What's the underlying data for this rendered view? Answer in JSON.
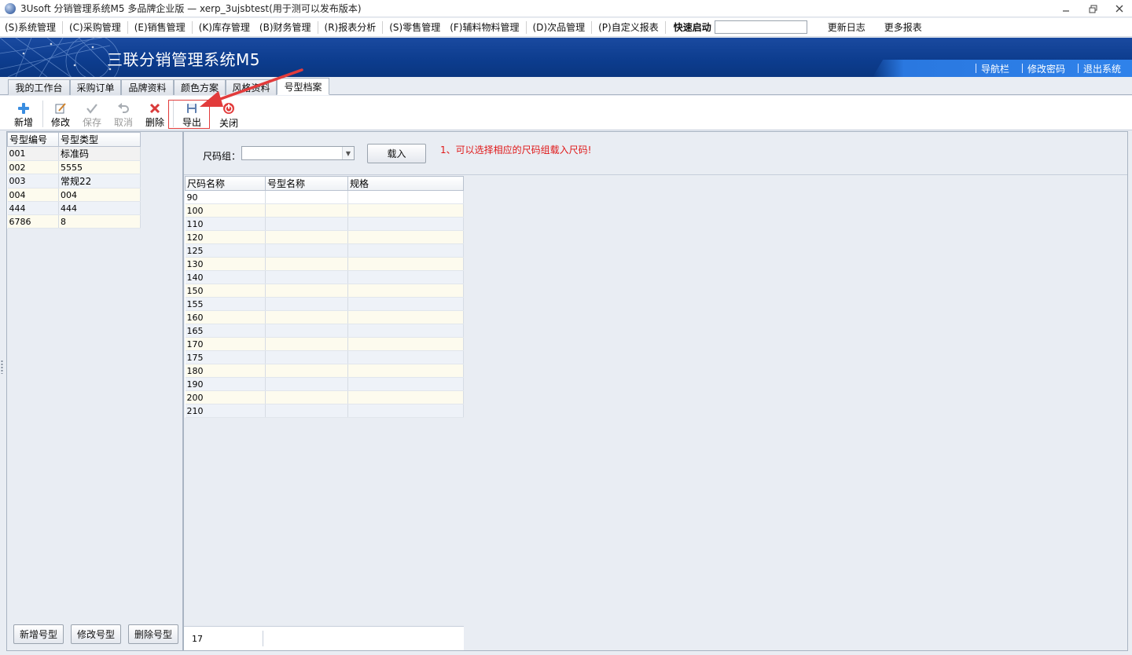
{
  "window": {
    "title": "3Usoft 分销管理系统M5 多品牌企业版 — xerp_3ujsbtest(用于测可以发布版本)",
    "min_icon": "minimize-icon",
    "restore_icon": "restore-icon",
    "close_icon": "close-icon"
  },
  "menu": {
    "items": [
      "(S)系统管理",
      "(C)采购管理",
      "(E)销售管理",
      "(K)库存管理",
      "(B)财务管理",
      "(R)报表分析",
      "(S)零售管理",
      "(F)辅料物料管理",
      "(D)次品管理",
      "(P)自定义报表"
    ],
    "quick_start_label": "快速启动",
    "quick_start_value": "",
    "update_log": "更新日志",
    "more_reports": "更多报表"
  },
  "banner": {
    "title": "三联分销管理系统M5",
    "links": [
      "导航栏",
      "修改密码",
      "退出系统"
    ]
  },
  "tabs": [
    "我的工作台",
    "采购订单",
    "品牌资料",
    "颜色方案",
    "风格资料",
    "号型档案"
  ],
  "active_tab": "号型档案",
  "toolbar": {
    "add": "新增",
    "edit": "修改",
    "save": "保存",
    "cancel": "取消",
    "delete": "删除",
    "export": "导出",
    "close": "关闭"
  },
  "left_grid": {
    "columns": [
      "号型编号",
      "号型类型"
    ],
    "rows": [
      [
        "001",
        "标准码"
      ],
      [
        "002",
        "5555"
      ],
      [
        "003",
        "常规22"
      ],
      [
        "004",
        "004"
      ],
      [
        "444",
        "444"
      ],
      [
        "6786",
        "8"
      ]
    ],
    "buttons": [
      "新增号型",
      "修改号型",
      "删除号型"
    ]
  },
  "filter": {
    "label": "尺码组：",
    "combo_value": "",
    "load_button": "载入",
    "hint": "1、可以选择相应的尺码组载入尺码!"
  },
  "size_grid": {
    "columns": [
      "尺码名称",
      "号型名称",
      "规格"
    ],
    "rows": [
      "90",
      "100",
      "110",
      "120",
      "125",
      "130",
      "140",
      "150",
      "155",
      "160",
      "165",
      "170",
      "175",
      "180",
      "190",
      "200",
      "210"
    ],
    "footer_count": "17"
  },
  "colors": {
    "banner": "#0d3d8f",
    "hint": "#e01818",
    "highlight": "#e23b3b"
  }
}
